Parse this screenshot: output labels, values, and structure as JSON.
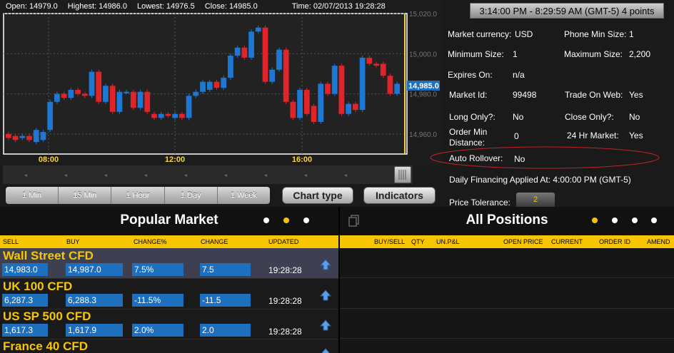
{
  "ohlc": {
    "open": "Open:  14979.0",
    "high": "Highest:  14986.0",
    "low": "Lowest:  14976.5",
    "close": "Close:  14985.0",
    "time": "Time:  02/07/2013 19:28:28"
  },
  "chart": {
    "y_ticks": [
      "15,020.0",
      "15,000.0",
      "14,980.0",
      "14,960.0"
    ],
    "x_ticks": [
      "08:00",
      "12:00",
      "16:00"
    ],
    "current_price_label": "14,985.0",
    "colors": {
      "up": "#1f77d4",
      "down": "#e0242a",
      "cursor": "#f7d53a",
      "price_tag": "#1f6fbf"
    }
  },
  "chart_data": {
    "type": "candlestick",
    "y_unit": "index points",
    "ylim": [
      14950,
      15020
    ],
    "candles": [
      {
        "o": 14960,
        "c": 14958
      },
      {
        "o": 14959,
        "c": 14957
      },
      {
        "o": 14958,
        "c": 14959
      },
      {
        "o": 14959,
        "c": 14957
      },
      {
        "o": 14956,
        "c": 14962
      },
      {
        "o": 14957,
        "c": 14961
      },
      {
        "o": 14962,
        "c": 14976
      },
      {
        "o": 14976,
        "c": 14980
      },
      {
        "o": 14980,
        "c": 14978
      },
      {
        "o": 14978,
        "c": 14982
      },
      {
        "o": 14982,
        "c": 14980
      },
      {
        "o": 14980,
        "c": 14979
      },
      {
        "o": 14979,
        "c": 14991
      },
      {
        "o": 14991,
        "c": 14976
      },
      {
        "o": 14976,
        "c": 14984
      },
      {
        "o": 14984,
        "c": 14971
      },
      {
        "o": 14971,
        "c": 14981
      },
      {
        "o": 14981,
        "c": 14981
      },
      {
        "o": 14981,
        "c": 14973
      },
      {
        "o": 14973,
        "c": 14981
      },
      {
        "o": 14981,
        "c": 14971
      },
      {
        "o": 14970,
        "c": 14968
      },
      {
        "o": 14968,
        "c": 14970
      },
      {
        "o": 14970,
        "c": 14969
      },
      {
        "o": 14968,
        "c": 14970
      },
      {
        "o": 14970,
        "c": 14968
      },
      {
        "o": 14968,
        "c": 14979
      },
      {
        "o": 14979,
        "c": 14981
      },
      {
        "o": 14981,
        "c": 14986
      },
      {
        "o": 14982,
        "c": 14986
      },
      {
        "o": 14986,
        "c": 14983
      },
      {
        "o": 14983,
        "c": 14988
      },
      {
        "o": 14988,
        "c": 14999
      },
      {
        "o": 14999,
        "c": 15003
      },
      {
        "o": 15003,
        "c": 14998
      },
      {
        "o": 14998,
        "c": 15011
      },
      {
        "o": 15011,
        "c": 15013
      },
      {
        "o": 15013,
        "c": 14986
      },
      {
        "o": 14986,
        "c": 14992
      },
      {
        "o": 14992,
        "c": 15002
      },
      {
        "o": 15002,
        "c": 14976
      },
      {
        "o": 14976,
        "c": 14968
      },
      {
        "o": 14968,
        "c": 14982
      },
      {
        "o": 14982,
        "c": 14970
      },
      {
        "o": 14974,
        "c": 14966
      },
      {
        "o": 14966,
        "c": 14985
      },
      {
        "o": 14985,
        "c": 14980
      },
      {
        "o": 14980,
        "c": 14994
      },
      {
        "o": 14994,
        "c": 14970
      },
      {
        "o": 14970,
        "c": 14975
      },
      {
        "o": 14975,
        "c": 14972
      },
      {
        "o": 14972,
        "c": 14998
      },
      {
        "o": 14998,
        "c": 14995
      },
      {
        "o": 14995,
        "c": 14994
      },
      {
        "o": 14995,
        "c": 14989
      },
      {
        "o": 14989,
        "c": 14980
      },
      {
        "o": 14980,
        "c": 14985
      }
    ]
  },
  "timeframes": [
    "1 Min",
    "15 Min",
    "1 Hour",
    "1 Day",
    "1 Week"
  ],
  "chart_type_label": "Chart type",
  "indicators_label": "Indicators",
  "info": {
    "time_range": "3:14:00 PM - 8:29:59 AM (GMT-5) 4 points",
    "market_currency_label": "Market currency:",
    "market_currency_value": "USD",
    "phone_min_label": "Phone Min Size:",
    "phone_min_value": "1",
    "min_size_label": "Minimum Size:",
    "min_size_value": "1",
    "max_size_label": "Maximum Size:",
    "max_size_value": "2,200",
    "expires_label": "Expires On:",
    "expires_value": "n/a",
    "market_id_label": "Market Id:",
    "market_id_value": "99498",
    "trade_web_label": "Trade On Web:",
    "trade_web_value": "Yes",
    "long_only_label": "Long Only?:",
    "long_only_value": "No",
    "close_only_label": "Close Only?:",
    "close_only_value": "No",
    "order_min_label_1": "Order Min",
    "order_min_label_2": "Distance:",
    "order_min_value": "0",
    "hr24_label": "24 Hr Market:",
    "hr24_value": "Yes",
    "auto_rollover_label": "Auto Rollover:",
    "auto_rollover_value": "No",
    "daily_financing": "Daily Financing Applied At: 4:00:00 PM (GMT-5)",
    "price_tolerance_label": "Price Tolerance:",
    "price_tolerance_value": "2"
  },
  "popular_market": {
    "title": "Popular Market",
    "columns": [
      "SELL",
      "BUY",
      "CHANGE%",
      "CHANGE",
      "UPDATED"
    ],
    "rows": [
      {
        "name": "Wall Street CFD",
        "sell": "14,983.0",
        "buy": "14,987.0",
        "change_pct": "7.5%",
        "change": "7.5",
        "updated": "19:28:28"
      },
      {
        "name": "UK 100 CFD",
        "sell": "6,287.3",
        "buy": "6,288.3",
        "change_pct": "-11.5%",
        "change": "-11.5",
        "updated": "19:28:28"
      },
      {
        "name": "US SP 500 CFD",
        "sell": "1,617.3",
        "buy": "1,617.9",
        "change_pct": "2.0%",
        "change": "2.0",
        "updated": "19:28:28"
      },
      {
        "name": "France 40 CFD"
      }
    ]
  },
  "positions": {
    "title": "All Positions",
    "columns": [
      "BUY/SELL",
      "QTY",
      "UN.P&L",
      "OPEN PRICE",
      "CURRENT",
      "ORDER ID",
      "AMEND"
    ]
  }
}
